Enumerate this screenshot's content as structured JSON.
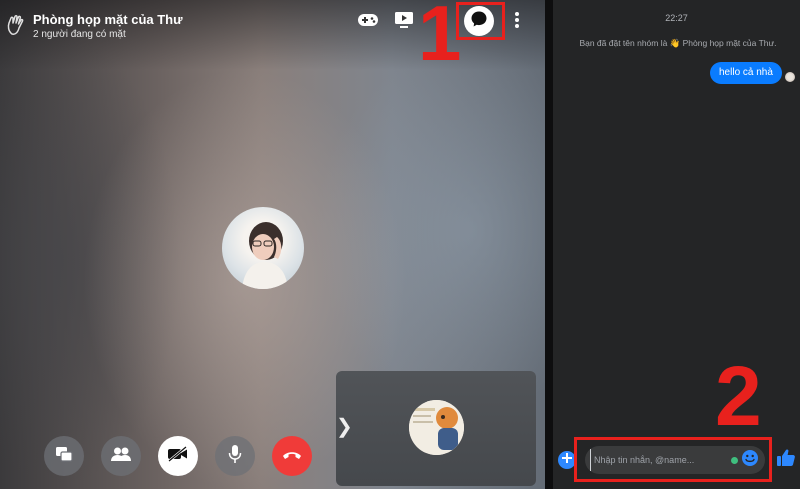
{
  "call": {
    "title": "Phòng họp mặt của Thư",
    "subtitle": "2 người đang có mặt",
    "header_icons": [
      "waving-hand-icon",
      "game-controller-icon",
      "screen-share-icon",
      "chat-bubble-icon",
      "more-vertical-icon"
    ],
    "controls": [
      "switch-view-icon",
      "participants-icon",
      "video-off-icon",
      "microphone-icon",
      "end-call-icon"
    ],
    "thumbnail_arrow": "❯"
  },
  "chat": {
    "time": "22:27",
    "system_message": "Bạn đã đặt tên nhóm là 👋 Phòng họp mặt của Thư.",
    "messages": [
      {
        "text": "hello cả nhà",
        "sender": "me"
      }
    ],
    "composer_placeholder": "Nhập tin nhắn, @name...",
    "composer_icons": [
      "add-icon",
      "emoji-icon",
      "thumbs-up-icon"
    ]
  },
  "annotations": {
    "label_1": "1",
    "label_2": "2",
    "color": "#e8211d"
  },
  "colors": {
    "accent_blue": "#0a7cff",
    "end_call_red": "#f03b39",
    "chat_bg": "#242526",
    "online_green": "#3fbf7f"
  }
}
